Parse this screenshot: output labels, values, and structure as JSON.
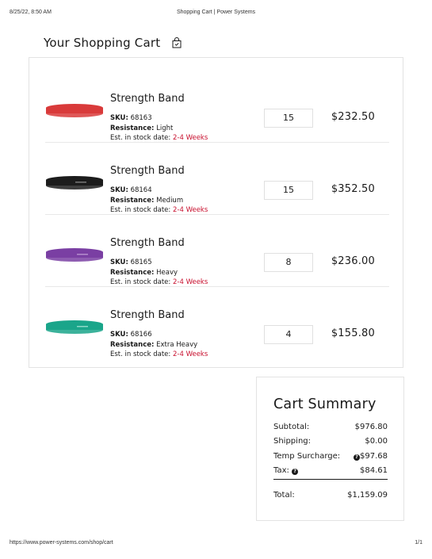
{
  "print_header": {
    "datetime": "8/25/22, 8:50 AM",
    "page_title": "Shopping Cart | Power Systems"
  },
  "print_footer": {
    "url": "https://www.power-systems.com/shop/cart",
    "page_count": "1/1"
  },
  "page": {
    "title": "Your Shopping Cart",
    "title_icon": "cart-check-icon"
  },
  "cart": {
    "sku_label": "SKU:",
    "resistance_label": "Resistance:",
    "stock_label": "Est. in stock date:",
    "items": [
      {
        "name": "Strength Band",
        "sku": "68163",
        "resistance": "Light",
        "stock_date": "2-4 Weeks",
        "quantity": "15",
        "price": "$232.50",
        "color": "#d93a3a"
      },
      {
        "name": "Strength Band",
        "sku": "68164",
        "resistance": "Medium",
        "stock_date": "2-4 Weeks",
        "quantity": "15",
        "price": "$352.50",
        "color": "#1c1c1c"
      },
      {
        "name": "Strength Band",
        "sku": "68165",
        "resistance": "Heavy",
        "stock_date": "2-4 Weeks",
        "quantity": "8",
        "price": "$236.00",
        "color": "#7a3fa3"
      },
      {
        "name": "Strength Band",
        "sku": "68166",
        "resistance": "Extra Heavy",
        "stock_date": "2-4 Weeks",
        "quantity": "4",
        "price": "$155.80",
        "color": "#1aa58a"
      }
    ]
  },
  "summary": {
    "title": "Cart Summary",
    "subtotal_label": "Subtotal:",
    "subtotal": "$976.80",
    "shipping_label": "Shipping:",
    "shipping": "$0.00",
    "surcharge_label": "Temp Surcharge:",
    "surcharge": "$97.68",
    "tax_label": "Tax:",
    "tax": "$84.61",
    "total_label": "Total:",
    "total": "$1,159.09",
    "help_icon": "question-circle-icon"
  },
  "colors": {
    "stock_date_red": "#c8102e",
    "border": "#e3e3e3"
  }
}
